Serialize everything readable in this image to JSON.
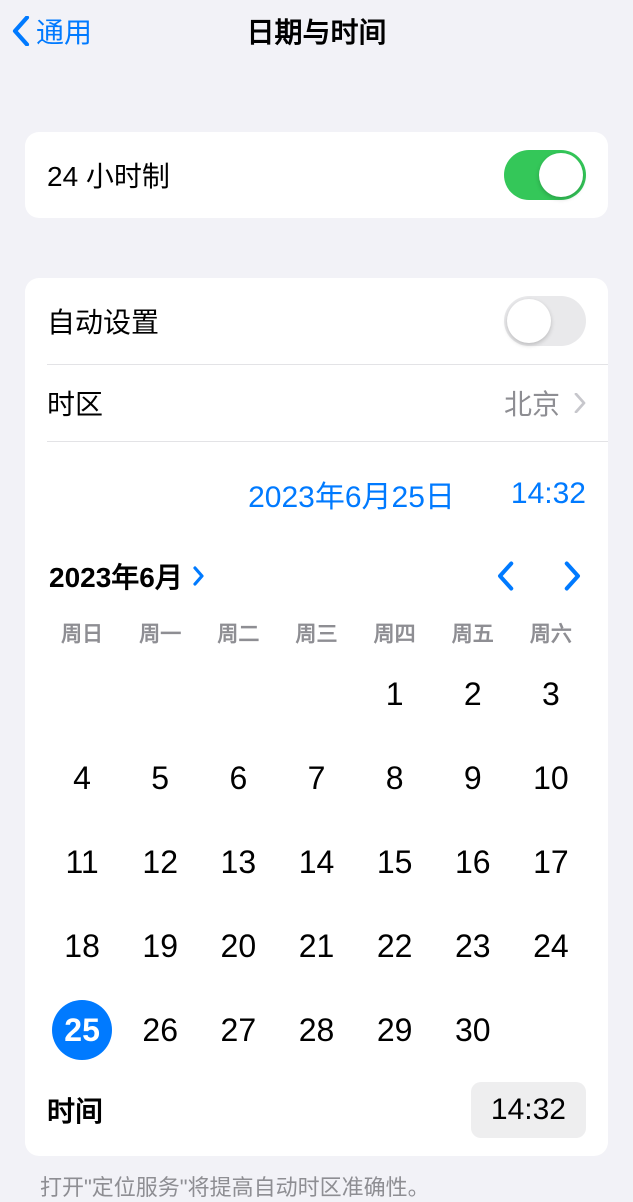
{
  "header": {
    "back_label": "通用",
    "title": "日期与时间"
  },
  "twentyfour_hour": {
    "label": "24 小时制",
    "enabled": true
  },
  "auto_set": {
    "label": "自动设置",
    "enabled": false
  },
  "timezone": {
    "label": "时区",
    "value": "北京"
  },
  "current_datetime": {
    "date": "2023年6月25日",
    "time": "14:32"
  },
  "calendar": {
    "month_label": "2023年6月",
    "weekdays": [
      "周日",
      "周一",
      "周二",
      "周三",
      "周四",
      "周五",
      "周六"
    ],
    "leading_blanks": 4,
    "days": [
      1,
      2,
      3,
      4,
      5,
      6,
      7,
      8,
      9,
      10,
      11,
      12,
      13,
      14,
      15,
      16,
      17,
      18,
      19,
      20,
      21,
      22,
      23,
      24,
      25,
      26,
      27,
      28,
      29,
      30
    ],
    "selected_day": 25
  },
  "time_row": {
    "label": "时间",
    "value": "14:32"
  },
  "footer_note": "打开\"定位服务\"将提高自动时区准确性。"
}
